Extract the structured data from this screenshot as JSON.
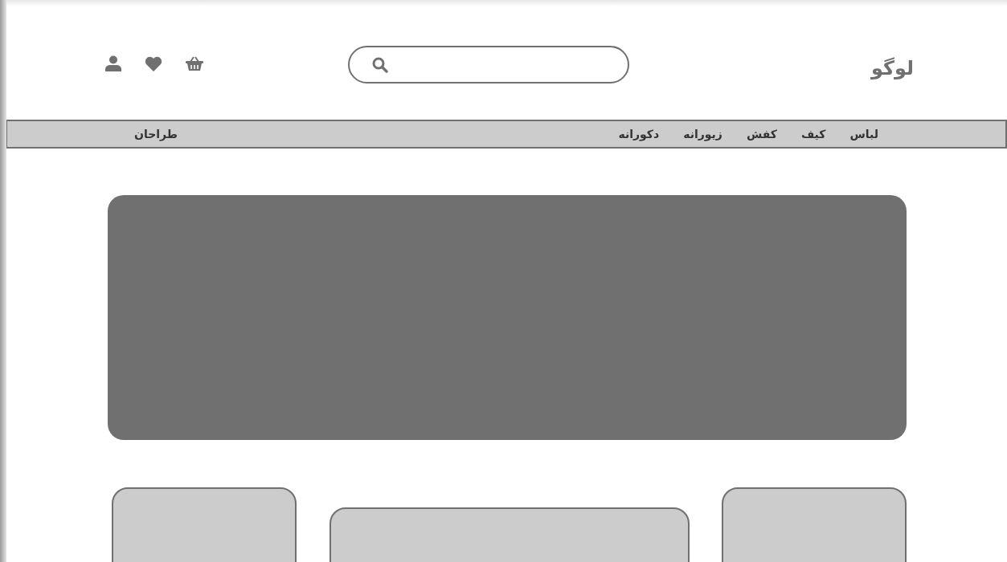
{
  "header": {
    "logo": "لوگو",
    "search": {
      "kind": "search"
    }
  },
  "nav": {
    "items": [
      "لباس",
      "کیف",
      "کفش",
      "زیورانه",
      "دکورانه"
    ],
    "end_item": "طراحان"
  },
  "cards": [
    {
      "kind": "tall"
    },
    {
      "kind": "short"
    },
    {
      "kind": "tall"
    }
  ]
}
